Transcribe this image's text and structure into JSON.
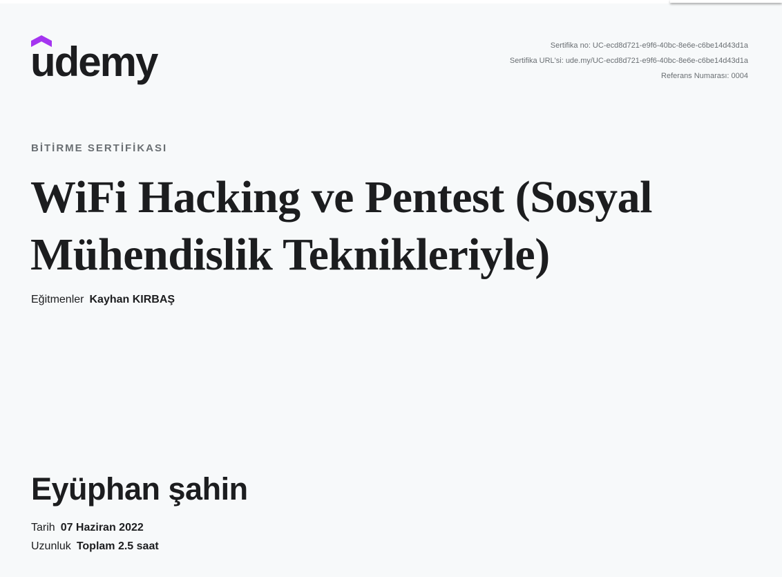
{
  "logo": {
    "text": "udemy",
    "accent_color": "#a435f0"
  },
  "certificate": {
    "number_line": "Sertifika no: UC-ecd8d721-e9f6-40bc-8e6e-c6be14d43d1a",
    "url_line": "Sertifika URL'si: ude.my/UC-ecd8d721-e9f6-40bc-8e6e-c6be14d43d1a",
    "reference_line": "Referans Numarası: 0004"
  },
  "kicker": "BİTİRME SERTİFİKASI",
  "course_title_line1": "WiFi Hacking ve Pentest (Sosyal",
  "course_title_line2": "Mühendislik Teknikleriyle)",
  "instructors": {
    "label": "Eğitmenler",
    "value": "Kayhan KIRBAŞ"
  },
  "student_name": "Eyüphan şahin",
  "date": {
    "label": "Tarih",
    "value": "07 Haziran 2022"
  },
  "length": {
    "label": "Uzunluk",
    "value": "Toplam 2.5 saat"
  }
}
